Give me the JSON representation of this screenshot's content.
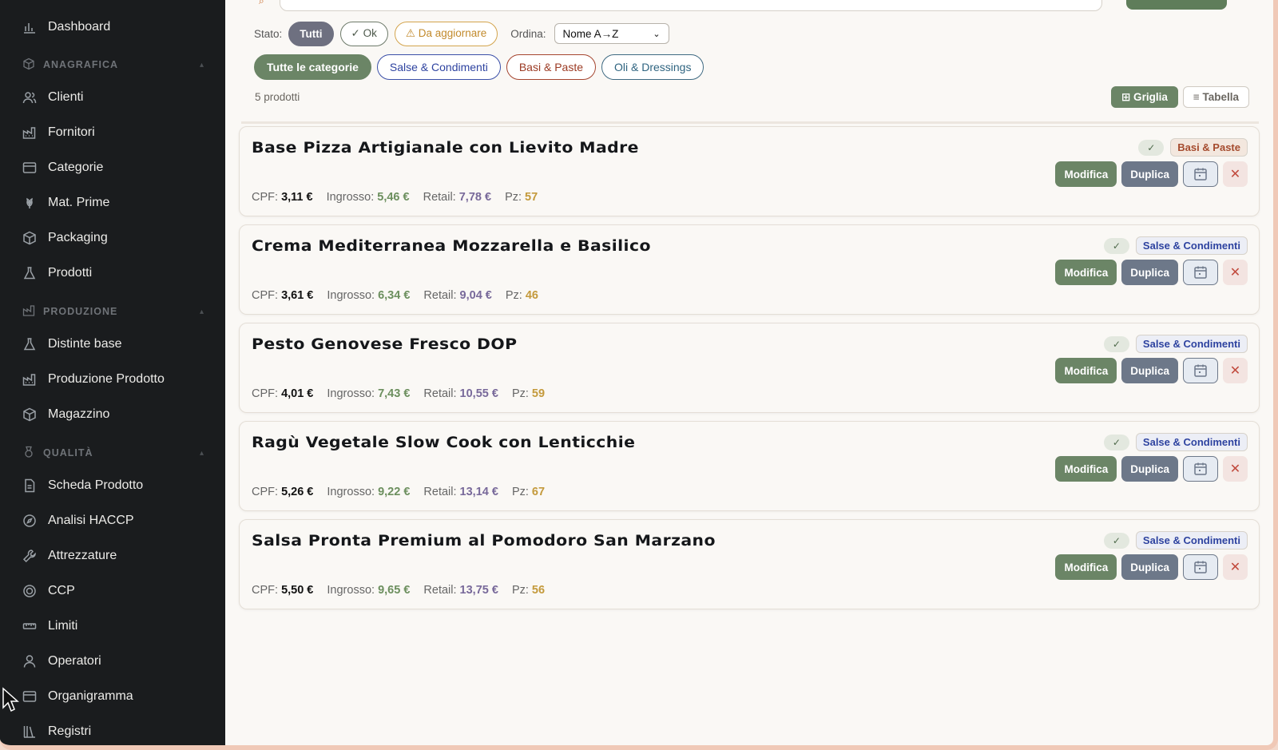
{
  "sidebar": {
    "items": [
      {
        "label": "Dashboard",
        "icon": "bar-chart-icon"
      },
      {
        "label": "Clienti",
        "icon": "users-icon"
      },
      {
        "label": "Fornitori",
        "icon": "factory-icon"
      },
      {
        "label": "Categorie",
        "icon": "folder-icon"
      },
      {
        "label": "Mat. Prime",
        "icon": "wheat-icon"
      },
      {
        "label": "Packaging",
        "icon": "box-icon"
      },
      {
        "label": "Prodotti",
        "icon": "flask-icon"
      },
      {
        "label": "Distinte base",
        "icon": "flask-icon"
      },
      {
        "label": "Produzione Prodotto",
        "icon": "factory-icon"
      },
      {
        "label": "Magazzino",
        "icon": "box-icon"
      },
      {
        "label": "Scheda Prodotto",
        "icon": "file-icon"
      },
      {
        "label": "Analisi HACCP",
        "icon": "compass-icon"
      },
      {
        "label": "Attrezzature",
        "icon": "wrench-icon"
      },
      {
        "label": "CCP",
        "icon": "target-icon"
      },
      {
        "label": "Limiti",
        "icon": "ruler-icon"
      },
      {
        "label": "Operatori",
        "icon": "user-icon"
      },
      {
        "label": "Organigramma",
        "icon": "folder-icon"
      },
      {
        "label": "Registri",
        "icon": "library-icon"
      }
    ],
    "sections": [
      {
        "label": "ANAGRAFICA",
        "icon": "cube-icon"
      },
      {
        "label": "PRODUZIONE",
        "icon": "factory-icon"
      },
      {
        "label": "QUALITÀ",
        "icon": "medal-icon"
      }
    ]
  },
  "filters": {
    "status_label": "Stato:",
    "status_options": [
      "Tutti",
      "✓ Ok",
      "⚠ Da aggiornare"
    ],
    "order_label": "Ordina:",
    "order_value": "Nome A→Z"
  },
  "categories": [
    "Tutte le categorie",
    "Salse & Condimenti",
    "Basi & Paste",
    "Oli & Dressings"
  ],
  "summary": {
    "count_text": "5 prodotti",
    "view_grid": "⊞ Griglia",
    "view_table": "≡ Tabella"
  },
  "labels": {
    "cpf": "CPF:",
    "ingrosso": "Ingrosso:",
    "retail": "Retail:",
    "pz": "Pz:",
    "edit": "Modifica",
    "duplicate": "Duplica",
    "check": "✓",
    "delete": "✕"
  },
  "products": [
    {
      "name": "Base Pizza Artigianale con Lievito Madre",
      "category": "Basi & Paste",
      "cpf": "3,11 €",
      "ingrosso": "5,46 €",
      "retail": "7,78 €",
      "pz": "57"
    },
    {
      "name": "Crema Mediterranea Mozzarella e Basilico",
      "category": "Salse & Condimenti",
      "cpf": "3,61 €",
      "ingrosso": "6,34 €",
      "retail": "9,04 €",
      "pz": "46"
    },
    {
      "name": "Pesto Genovese Fresco DOP",
      "category": "Salse & Condimenti",
      "cpf": "4,01 €",
      "ingrosso": "7,43 €",
      "retail": "10,55 €",
      "pz": "59"
    },
    {
      "name": "Ragù Vegetale Slow Cook con Lenticchie",
      "category": "Salse & Condimenti",
      "cpf": "5,26 €",
      "ingrosso": "9,22 €",
      "retail": "13,14 €",
      "pz": "67"
    },
    {
      "name": "Salsa Pronta Premium al Pomodoro San Marzano",
      "category": "Salse & Condimenti",
      "cpf": "5,50 €",
      "ingrosso": "9,65 €",
      "retail": "13,75 €",
      "pz": "56"
    }
  ],
  "colors": {
    "sidebar_bg": "#1a1c1e",
    "primary_green": "#6b8566",
    "slate": "#6d7889",
    "danger": "#c14a3d"
  }
}
